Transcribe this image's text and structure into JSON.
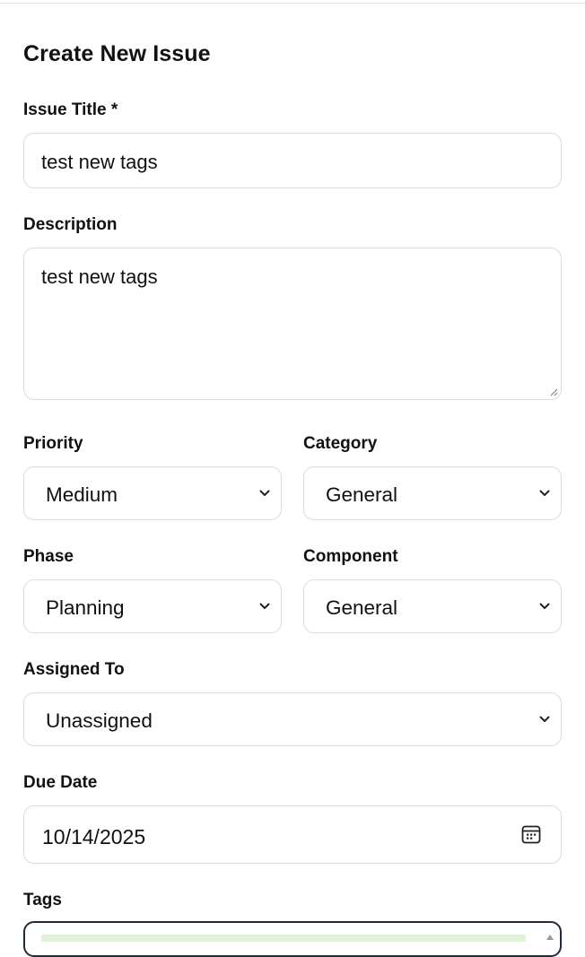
{
  "form": {
    "heading": "Create New Issue",
    "issue_title": {
      "label": "Issue Title *",
      "value": "test new tags"
    },
    "description": {
      "label": "Description",
      "value": "test new tags"
    },
    "priority": {
      "label": "Priority",
      "value": "Medium"
    },
    "category": {
      "label": "Category",
      "value": "General"
    },
    "phase": {
      "label": "Phase",
      "value": "Planning"
    },
    "component": {
      "label": "Component",
      "value": "General"
    },
    "assigned_to": {
      "label": "Assigned To",
      "value": "Unassigned"
    },
    "due_date": {
      "label": "Due Date",
      "value": "10/14/2025"
    },
    "tags": {
      "label": "Tags"
    }
  },
  "icons": {
    "select": "chevron-down-icon",
    "date": "calendar-icon",
    "resize": "resize-handle-icon"
  },
  "colors": {
    "border": "#dcdcdc",
    "focused_border": "#1f2a3a",
    "tag_highlight": "#dff3d9"
  }
}
